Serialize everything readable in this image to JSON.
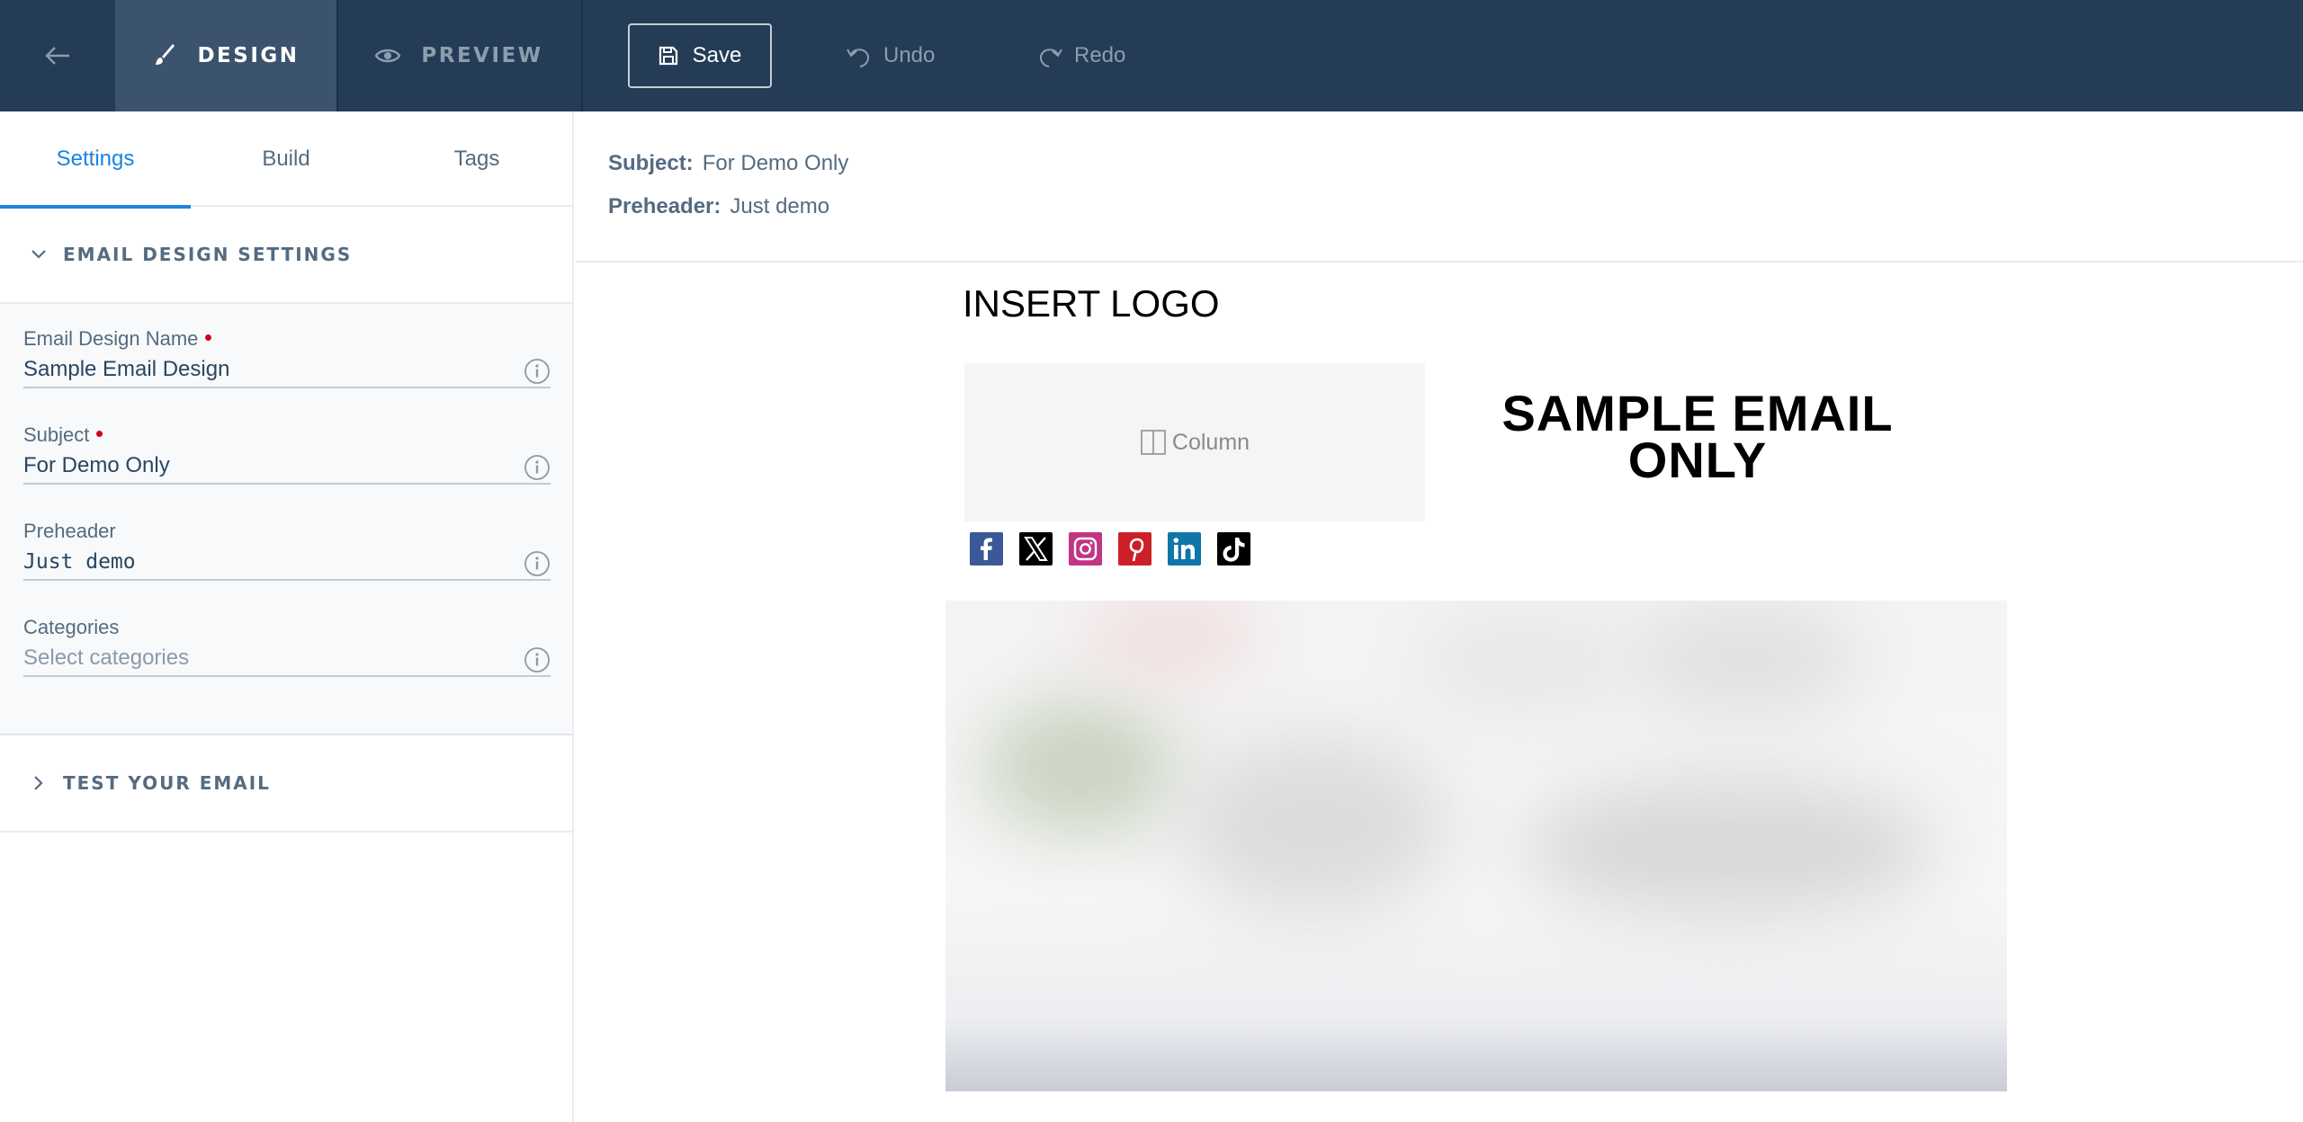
{
  "topbar": {
    "design_label": "DESIGN",
    "preview_label": "PREVIEW",
    "save_label": "Save",
    "undo_label": "Undo",
    "redo_label": "Redo"
  },
  "sidebar": {
    "tabs": [
      {
        "label": "Settings",
        "active": true
      },
      {
        "label": "Build",
        "active": false
      },
      {
        "label": "Tags",
        "active": false
      }
    ],
    "design_settings_title": "EMAIL DESIGN SETTINGS",
    "fields": {
      "design_name": {
        "label": "Email Design Name",
        "value": "Sample Email Design"
      },
      "subject": {
        "label": "Subject",
        "value": "For Demo Only"
      },
      "preheader": {
        "label": "Preheader",
        "value": "Just demo"
      },
      "categories": {
        "label": "Categories",
        "placeholder": "Select categories"
      }
    },
    "test_email_title": "TEST YOUR EMAIL"
  },
  "meta": {
    "subject_label": "Subject:",
    "subject_value": "For Demo Only",
    "preheader_label": "Preheader:",
    "preheader_value": "Just demo"
  },
  "canvas": {
    "logo_text": "INSERT LOGO",
    "column_placeholder": "Column",
    "headline": "SAMPLE EMAIL ONLY",
    "social_icons": [
      "facebook-icon",
      "x-icon",
      "instagram-icon",
      "pinterest-icon",
      "linkedin-icon",
      "tiktok-icon"
    ]
  },
  "colors": {
    "topbar_bg": "#243c56",
    "active_mode_bg": "#3b536d",
    "accent": "#1a82e2",
    "required": "#d0021b"
  }
}
